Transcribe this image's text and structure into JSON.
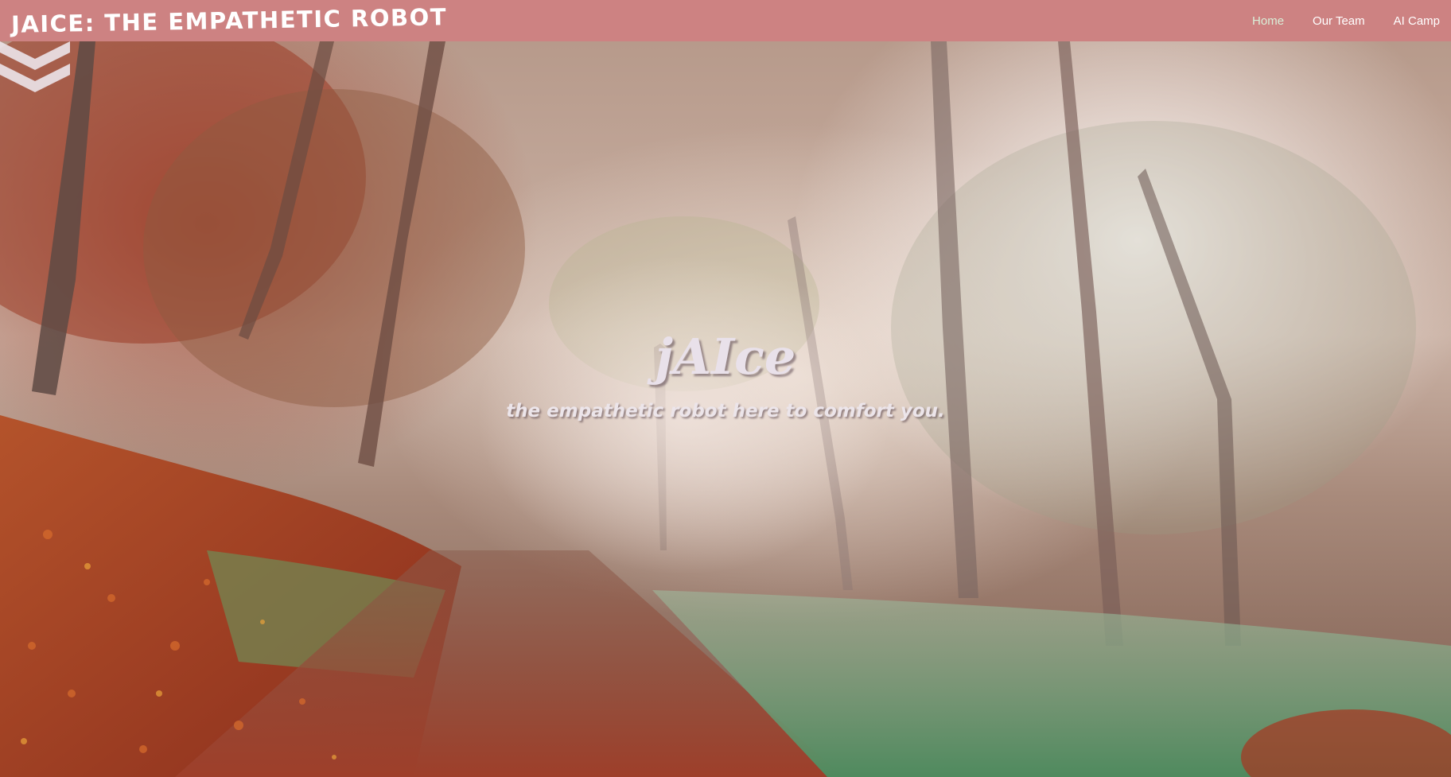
{
  "navbar": {
    "brand": "jAIce: the empathetic robot",
    "links": [
      {
        "label": "Home",
        "active": true
      },
      {
        "label": "Our Team",
        "active": false
      },
      {
        "label": "AI Camp",
        "active": false
      }
    ],
    "background_color": "#cd8282",
    "active_link_color": "#d9f0d9"
  },
  "hero": {
    "title": "jAIce",
    "subtitle": "the empathetic robot here to comfort you.",
    "scroll_icon": "double-chevron-down-icon"
  }
}
